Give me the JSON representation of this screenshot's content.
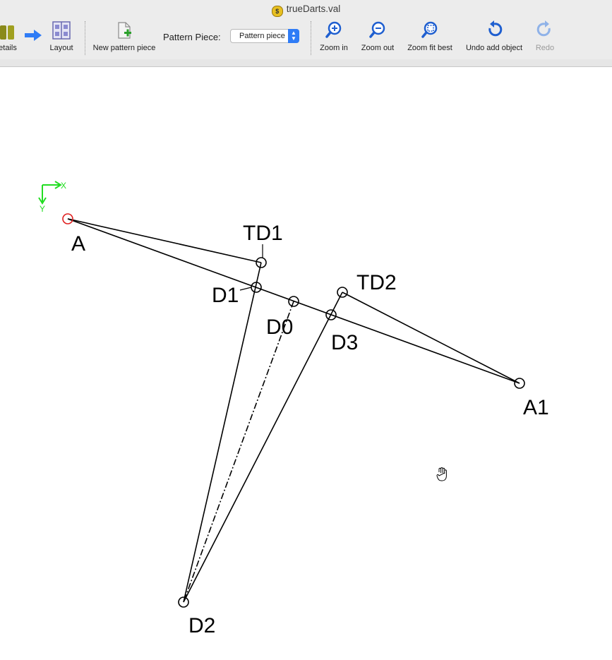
{
  "window": {
    "title": "trueDarts.val"
  },
  "toolbar": {
    "details_label": "etails",
    "layout_label": "Layout",
    "new_piece_label": "New pattern piece",
    "pattern_piece_label": "Pattern Piece:",
    "pattern_piece_value": "Pattern piece",
    "zoom_in_label": "Zoom in",
    "zoom_out_label": "Zoom out",
    "zoom_fit_label": "Zoom fit best",
    "undo_label": "Undo add object",
    "redo_label": "Redo"
  },
  "canvas": {
    "axis_x": "X",
    "axis_y": "Y",
    "points": {
      "A": "A",
      "TD1": "TD1",
      "D1": "D1",
      "D0": "D0",
      "TD2": "TD2",
      "D3": "D3",
      "A1": "A1",
      "D2": "D2"
    }
  },
  "colors": {
    "accent": "#2f7cf6",
    "origin_point": "#e02020",
    "axis": "#22dd22",
    "icon_blue": "#1f5fd0"
  }
}
